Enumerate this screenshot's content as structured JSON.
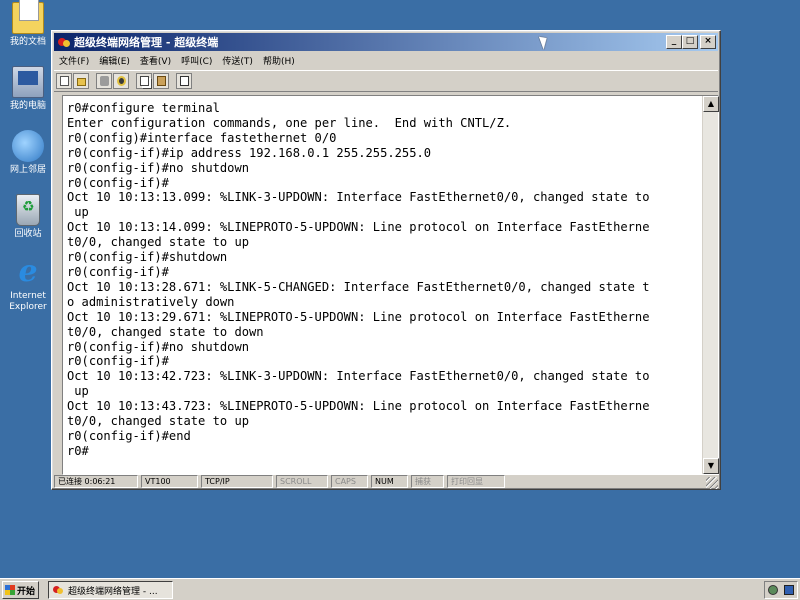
{
  "desktop": {
    "icons": [
      {
        "label": "我的文档",
        "icon": "my-documents-icon"
      },
      {
        "label": "我的电脑",
        "icon": "my-computer-icon"
      },
      {
        "label": "网上邻居",
        "icon": "network-places-icon"
      },
      {
        "label": "回收站",
        "icon": "recycle-bin-icon"
      },
      {
        "label": "Internet Explorer",
        "icon": "internet-explorer-icon"
      }
    ]
  },
  "window": {
    "title": "超级终端网络管理 - 超级终端",
    "controls": {
      "minimize": "_",
      "maximize": "□",
      "close": "×"
    },
    "menu": [
      "文件(F)",
      "编辑(E)",
      "查看(V)",
      "呼叫(C)",
      "传送(T)",
      "帮助(H)"
    ],
    "toolbar_icons": [
      "new-icon",
      "open-icon",
      "disconnect-icon",
      "record-icon",
      "copy-icon",
      "paste-icon",
      "properties-icon"
    ],
    "terminal_lines": [
      "r0#configure terminal",
      "Enter configuration commands, one per line.  End with CNTL/Z.",
      "r0(config)#interface fastethernet 0/0",
      "r0(config-if)#ip address 192.168.0.1 255.255.255.0",
      "r0(config-if)#no shutdown",
      "r0(config-if)#",
      "Oct 10 10:13:13.099: %LINK-3-UPDOWN: Interface FastEthernet0/0, changed state to",
      " up",
      "Oct 10 10:13:14.099: %LINEPROTO-5-UPDOWN: Line protocol on Interface FastEtherne",
      "t0/0, changed state to up",
      "r0(config-if)#shutdown",
      "r0(config-if)#",
      "Oct 10 10:13:28.671: %LINK-5-CHANGED: Interface FastEthernet0/0, changed state t",
      "o administratively down",
      "Oct 10 10:13:29.671: %LINEPROTO-5-UPDOWN: Line protocol on Interface FastEtherne",
      "t0/0, changed state to down",
      "r0(config-if)#no shutdown",
      "r0(config-if)#",
      "Oct 10 10:13:42.723: %LINK-3-UPDOWN: Interface FastEthernet0/0, changed state to",
      " up",
      "Oct 10 10:13:43.723: %LINEPROTO-5-UPDOWN: Line protocol on Interface FastEtherne",
      "t0/0, changed state to up",
      "r0(config-if)#end",
      "r0#"
    ],
    "status": {
      "connected": "已连接 0:06:21",
      "emulation": "VT100",
      "protocol": "TCP/IP",
      "scroll": "SCROLL",
      "caps": "CAPS",
      "num": "NUM",
      "capture": "捕获",
      "print_echo": "打印回显"
    }
  },
  "taskbar": {
    "start": "开始",
    "task": "超级终端网络管理 - ..."
  },
  "colors": {
    "desktop": "#3a6ea5",
    "titlebar_start": "#0a246a",
    "titlebar_end": "#a6caf0",
    "chrome": "#d4d0c8"
  }
}
